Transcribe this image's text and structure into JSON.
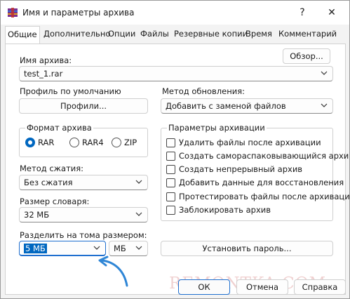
{
  "window": {
    "title": "Имя и параметры архива",
    "help_label": "?",
    "close_label": "✕",
    "app_icon": "winrar-icon"
  },
  "tabs": [
    {
      "label": "Общие",
      "active": true
    },
    {
      "label": "Дополнительно"
    },
    {
      "label": "Опции"
    },
    {
      "label": "Файлы"
    },
    {
      "label": "Резервные копии"
    },
    {
      "label": "Время"
    },
    {
      "label": "Комментарий"
    }
  ],
  "archive": {
    "name_label": "Имя архива:",
    "browse_label": "Обзор...",
    "name_value": "test_1.rar"
  },
  "profile": {
    "label": "Профиль по умолчанию",
    "button_label": "Профили..."
  },
  "update": {
    "label": "Метод обновления:",
    "value": "Добавить с заменой файлов"
  },
  "format": {
    "title": "Формат архива",
    "options": [
      {
        "label": "RAR",
        "selected": true
      },
      {
        "label": "RAR4",
        "selected": false
      },
      {
        "label": "ZIP",
        "selected": false
      }
    ]
  },
  "options": {
    "title": "Параметры архивации",
    "items": [
      {
        "label": "Удалить файлы после архивации",
        "checked": false
      },
      {
        "label": "Создать самораспаковывающийся архив",
        "checked": false
      },
      {
        "label": "Создать непрерывный архив",
        "checked": false
      },
      {
        "label": "Добавить данные для восстановления",
        "checked": false
      },
      {
        "label": "Протестировать файлы после архивации",
        "checked": false
      },
      {
        "label": "Заблокировать архив",
        "checked": false
      }
    ]
  },
  "compression": {
    "label": "Метод сжатия:",
    "value": "Без сжатия"
  },
  "dictionary": {
    "label": "Размер словаря:",
    "value": "32 МБ"
  },
  "split": {
    "label": "Разделить на тома размером:",
    "value": "5 МБ",
    "unit": "МБ"
  },
  "password_button": "Установить пароль...",
  "footer": {
    "ok": "ОК",
    "cancel": "Отмена",
    "help": "Справка"
  },
  "watermark": "REMONTKA.COM",
  "colors": {
    "accent": "#0067c0",
    "annotation_arrow": "#2f86d6"
  }
}
